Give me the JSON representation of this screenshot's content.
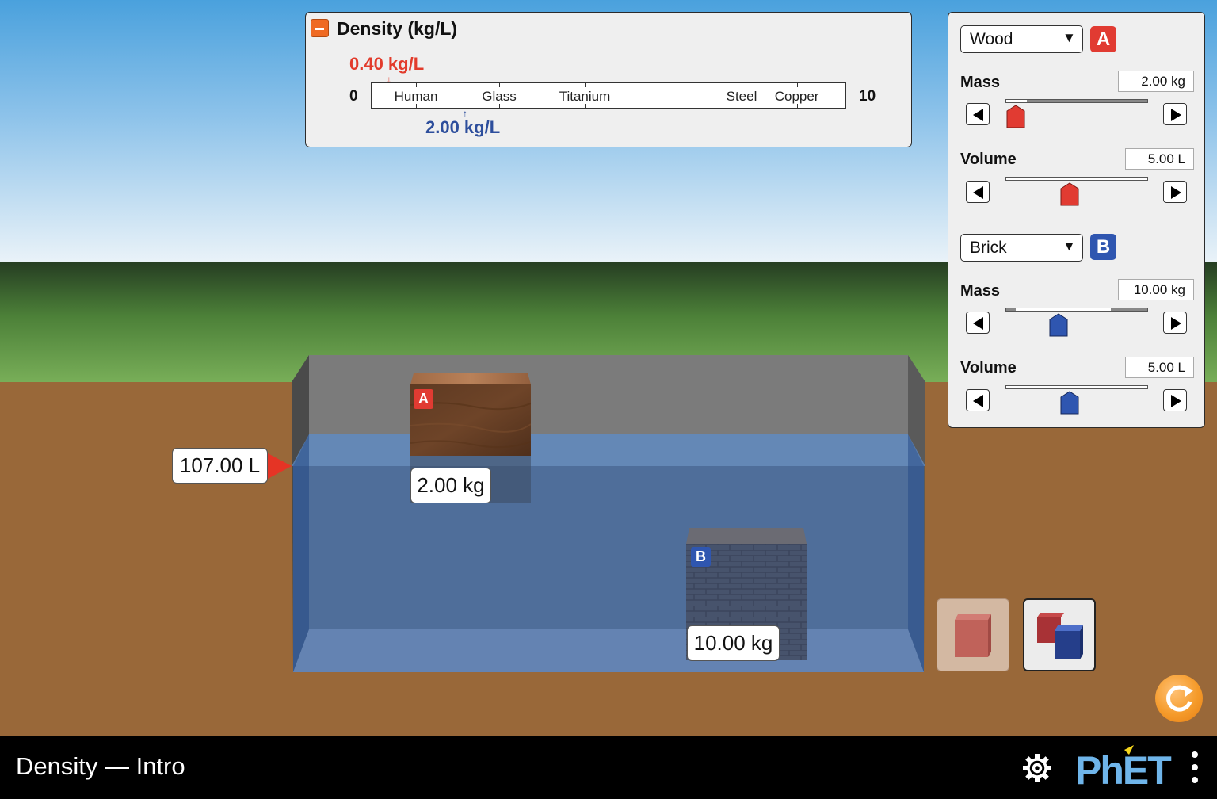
{
  "density_panel": {
    "title": "Density (kg/L)",
    "scale_min": "0",
    "scale_max": "10",
    "materials": [
      {
        "name": "Human",
        "density": 0.95
      },
      {
        "name": "Glass",
        "density": 2.7
      },
      {
        "name": "Titanium",
        "density": 4.5
      },
      {
        "name": "Steel",
        "density": 7.8
      },
      {
        "name": "Copper",
        "density": 8.96
      }
    ],
    "block_a_density": "0.40 kg/L",
    "block_b_density": "2.00 kg/L"
  },
  "controls": {
    "block_a": {
      "material": "Wood",
      "badge": "A",
      "mass_label": "Mass",
      "mass_value": "2.00 kg",
      "mass_fraction": 0.07,
      "volume_label": "Volume",
      "volume_value": "5.00 L",
      "volume_fraction": 0.45
    },
    "block_b": {
      "material": "Brick",
      "badge": "B",
      "mass_label": "Mass",
      "mass_value": "10.00 kg",
      "mass_fraction": 0.37,
      "volume_label": "Volume",
      "volume_value": "5.00 L",
      "volume_fraction": 0.45
    }
  },
  "scene": {
    "water_volume": "107.00 L",
    "block_a_label": "A",
    "block_a_mass": "2.00 kg",
    "block_b_label": "B",
    "block_b_mass": "10.00 kg"
  },
  "colors": {
    "block_a": "#e13b32",
    "block_b": "#2f56b0",
    "reset": "#f59b2b"
  },
  "navbar": {
    "title": "Density — Intro",
    "brand": "PhET"
  }
}
